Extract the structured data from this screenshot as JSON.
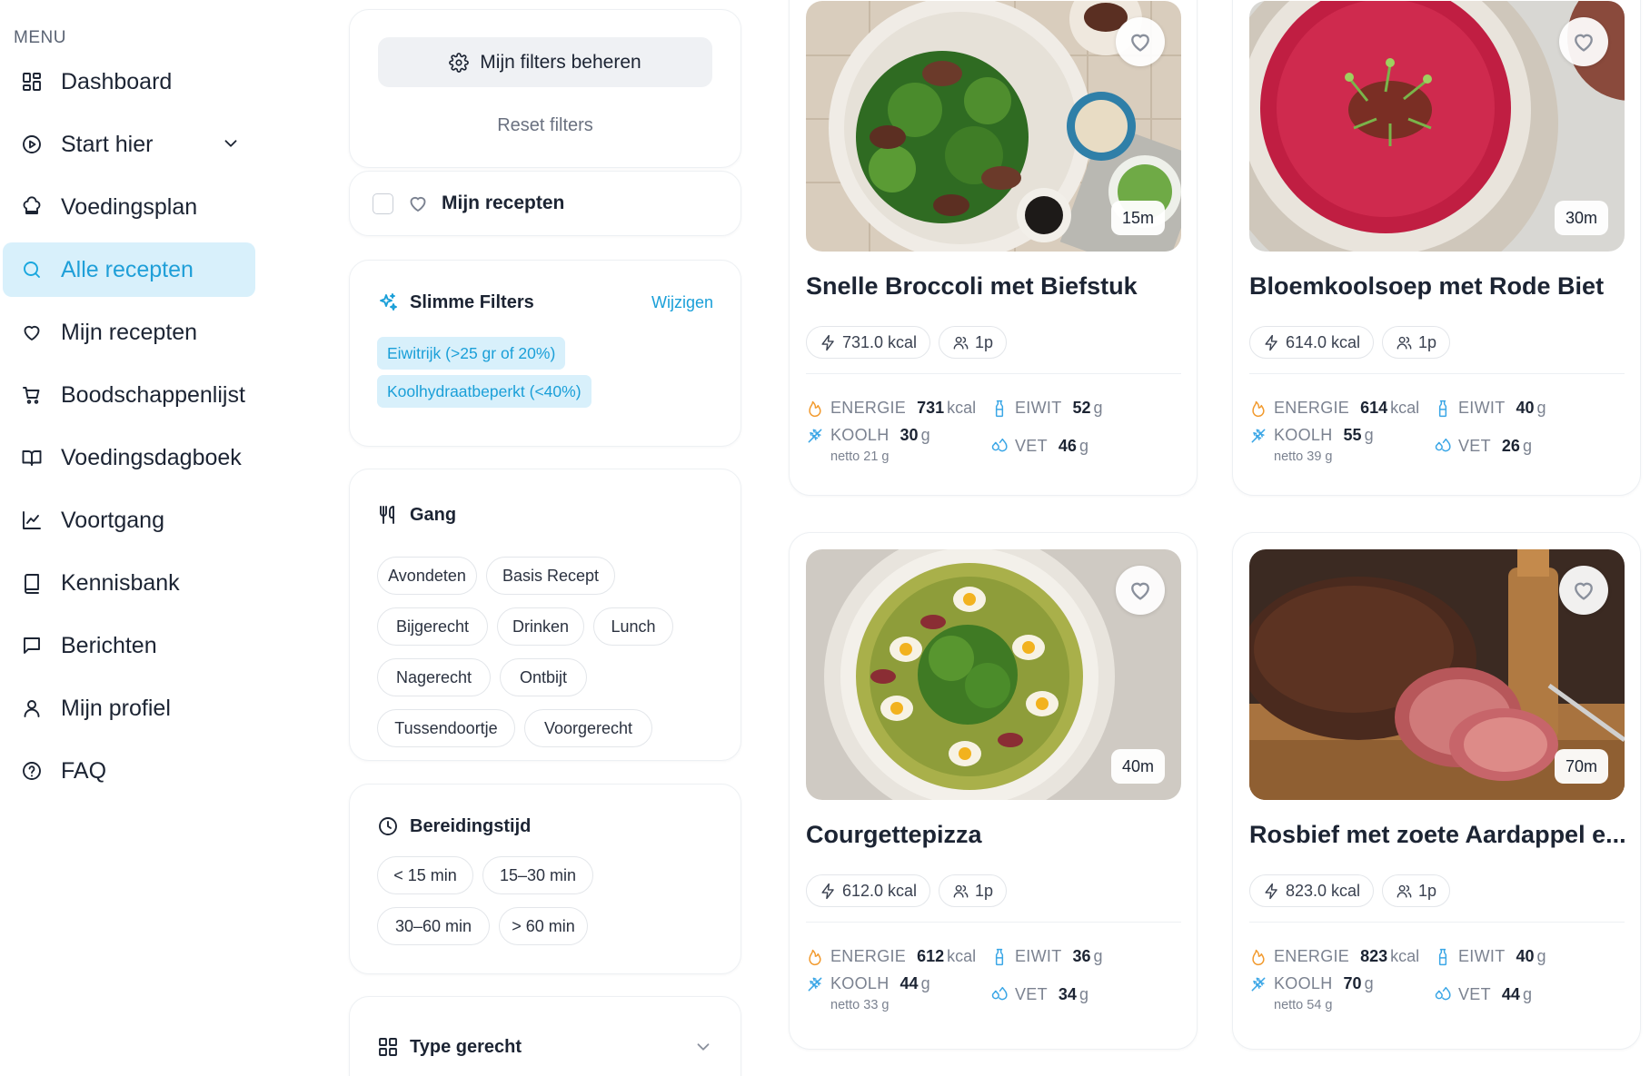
{
  "sidebar": {
    "menu_title": "MENU",
    "items": [
      {
        "label": "Dashboard",
        "icon": "dashboard-icon"
      },
      {
        "label": "Start hier",
        "icon": "play-circle-icon"
      },
      {
        "label": "Voedingsplan",
        "icon": "chef-hat-icon"
      },
      {
        "label": "Alle recepten",
        "icon": "search-icon"
      },
      {
        "label": "Mijn recepten",
        "icon": "heart-icon"
      },
      {
        "label": "Boodschappenlijst",
        "icon": "cart-icon"
      },
      {
        "label": "Voedingsdagboek",
        "icon": "book-open-icon"
      },
      {
        "label": "Voortgang",
        "icon": "chart-line-icon"
      },
      {
        "label": "Kennisbank",
        "icon": "book-icon"
      },
      {
        "label": "Berichten",
        "icon": "message-icon"
      },
      {
        "label": "Mijn profiel",
        "icon": "user-icon"
      },
      {
        "label": "FAQ",
        "icon": "help-circle-icon"
      }
    ],
    "active_item": "Alle recepten"
  },
  "filters": {
    "manage_label": "Mijn filters beheren",
    "reset_label": "Reset filters",
    "my_recipes_label": "Mijn recepten",
    "my_recipes_checked": false,
    "smart": {
      "title": "Slimme Filters",
      "edit_label": "Wijzigen",
      "tags": [
        "Eiwitrijk (>25 gr of 20%)",
        "Koolhydraatbeperkt (<40%)"
      ]
    },
    "gang": {
      "title": "Gang",
      "options": [
        "Avondeten",
        "Basis Recept",
        "Bijgerecht",
        "Drinken",
        "Lunch",
        "Nagerecht",
        "Ontbijt",
        "Tussendoortje",
        "Voorgerecht"
      ]
    },
    "time": {
      "title": "Bereidingstijd",
      "options": [
        "< 15 min",
        "15–30 min",
        "30–60 min",
        "> 60 min"
      ]
    },
    "type": {
      "title": "Type gerecht"
    }
  },
  "recipes": [
    {
      "title": "Snelle Broccoli met Biefstuk",
      "time": "15m",
      "kcal": "731.0 kcal",
      "persons": "1p",
      "energie": "731",
      "energie_unit": "kcal",
      "kooh": "30",
      "kooh_unit": "g",
      "netto": "netto 21 g",
      "eiwit": "52",
      "eiwit_unit": "g",
      "vet": "46",
      "vet_unit": "g"
    },
    {
      "title": "Bloemkoolsoep met Rode Biet",
      "time": "30m",
      "kcal": "614.0 kcal",
      "persons": "1p",
      "energie": "614",
      "energie_unit": "kcal",
      "kooh": "55",
      "kooh_unit": "g",
      "netto": "netto 39 g",
      "eiwit": "40",
      "eiwit_unit": "g",
      "vet": "26",
      "vet_unit": "g"
    },
    {
      "title": "Courgettepizza",
      "time": "40m",
      "kcal": "612.0 kcal",
      "persons": "1p",
      "energie": "612",
      "energie_unit": "kcal",
      "kooh": "44",
      "kooh_unit": "g",
      "netto": "netto 33 g",
      "eiwit": "36",
      "eiwit_unit": "g",
      "vet": "34",
      "vet_unit": "g"
    },
    {
      "title": "Rosbief met zoete Aardappel e...",
      "time": "70m",
      "kcal": "823.0 kcal",
      "persons": "1p",
      "energie": "823",
      "energie_unit": "kcal",
      "kooh": "70",
      "kooh_unit": "g",
      "netto": "netto 54 g",
      "eiwit": "40",
      "eiwit_unit": "g",
      "vet": "44",
      "vet_unit": "g"
    }
  ],
  "nutrient_labels": {
    "energie": "ENERGIE",
    "kooh": "KOOLH",
    "eiwit": "EIWIT",
    "vet": "VET"
  },
  "colors": {
    "accent": "#1a9fd8",
    "accent_bg": "#d8f0fb",
    "energy": "#f29a2e",
    "nutrient_blue": "#3aa6e6"
  }
}
